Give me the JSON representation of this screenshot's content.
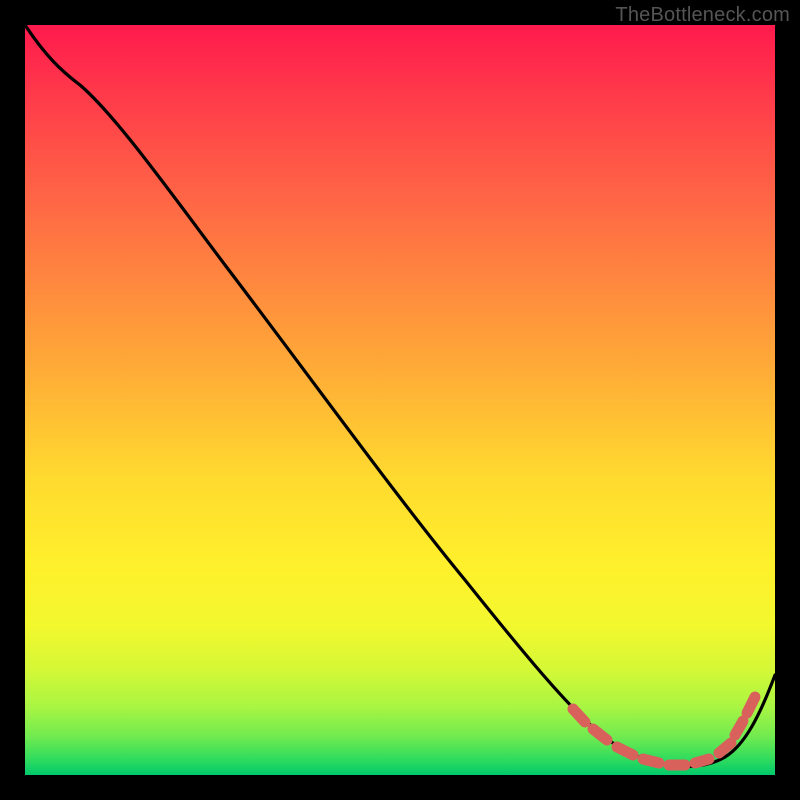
{
  "watermark": "TheBottleneck.com",
  "chart_data": {
    "type": "line",
    "title": "",
    "xlabel": "",
    "ylabel": "",
    "xlim": [
      0,
      100
    ],
    "ylim": [
      0,
      100
    ],
    "series": [
      {
        "name": "bottleneck-curve",
        "x": [
          0,
          3,
          8,
          15,
          25,
          35,
          45,
          55,
          62,
          68,
          72,
          75,
          78,
          82,
          86,
          90,
          93,
          96,
          100
        ],
        "y": [
          100,
          97,
          94,
          88,
          77,
          65,
          53,
          41,
          32,
          24,
          18,
          12,
          7,
          3,
          1,
          1,
          4,
          10,
          20
        ]
      }
    ],
    "highlight": {
      "name": "flat-region-dashes",
      "x_start": 72,
      "x_end": 92,
      "segments": 9
    },
    "background_gradient": {
      "stops": [
        {
          "pos": 0,
          "color": "#ff1a4d"
        },
        {
          "pos": 35,
          "color": "#ff8a3e"
        },
        {
          "pos": 60,
          "color": "#ffd92f"
        },
        {
          "pos": 86,
          "color": "#d4f836"
        },
        {
          "pos": 100,
          "color": "#00c96b"
        }
      ]
    }
  }
}
